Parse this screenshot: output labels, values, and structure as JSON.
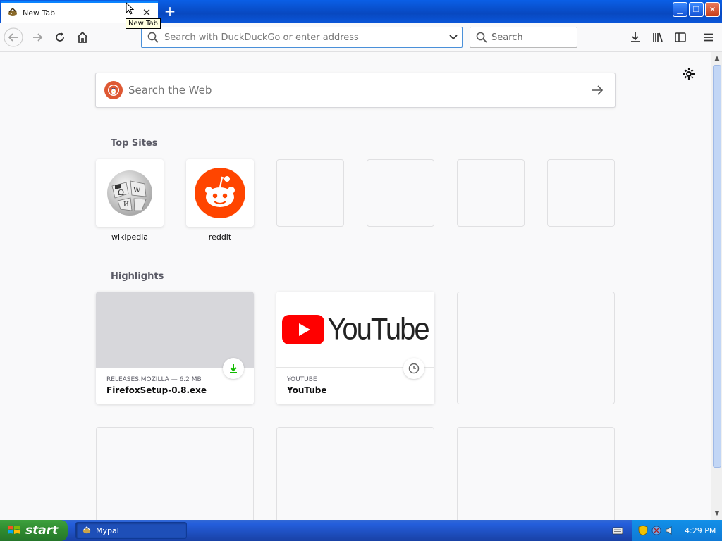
{
  "browser": {
    "tab": {
      "title": "New Tab",
      "tooltip": "New Tab"
    },
    "urlbar": {
      "placeholder": "Search with DuckDuckGo or enter address",
      "value": ""
    },
    "searchbar": {
      "placeholder": "Search"
    }
  },
  "newtab": {
    "websearch_placeholder": "Search the Web",
    "top_sites_title": "Top Sites",
    "top_sites": [
      {
        "label": "wikipedia",
        "icon": "wikipedia-globe-icon"
      },
      {
        "label": "reddit",
        "icon": "reddit-alien-icon"
      },
      {
        "label": "",
        "icon": ""
      },
      {
        "label": "",
        "icon": ""
      },
      {
        "label": "",
        "icon": ""
      },
      {
        "label": "",
        "icon": ""
      }
    ],
    "highlights_title": "Highlights",
    "highlights": [
      {
        "source": "RELEASES.MOZILLA — 6.2 MB",
        "title": "FirefoxSetup-0.8.exe",
        "badge": "download-icon"
      },
      {
        "source": "YOUTUBE",
        "title": "YouTube",
        "badge": "clock-icon",
        "logo_text": "YouTube"
      },
      {
        "source": "",
        "title": ""
      }
    ]
  },
  "taskbar": {
    "start_label": "start",
    "items": [
      {
        "label": "Mypal"
      }
    ],
    "clock": "4:29 PM"
  },
  "colors": {
    "accent": "#0a84ff",
    "reddit": "#ff4500",
    "youtube_red": "#ff0000",
    "download_green": "#12bc00",
    "ddg_orange": "#de5833"
  }
}
